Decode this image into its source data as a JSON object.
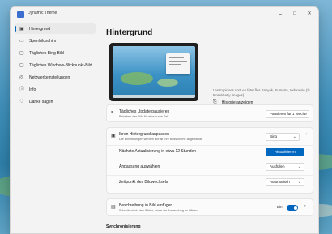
{
  "window": {
    "title": "Dynamic Theme",
    "minimize": "–",
    "maximize": "□",
    "close": "✕"
  },
  "sidebar": {
    "items": [
      {
        "label": "Hintergrund",
        "icon": "picture-icon",
        "active": true
      },
      {
        "label": "Sperrbildschirm",
        "icon": "monitor-icon",
        "active": false
      },
      {
        "label": "Tägliches Bing-Bild",
        "icon": "image-icon",
        "active": false
      },
      {
        "label": "Tägliches Windows-Blickpunkt-Bild",
        "icon": "image-icon",
        "active": false
      },
      {
        "label": "Netzwerkeinstellungen",
        "icon": "globe-icon",
        "active": false
      },
      {
        "label": "Info",
        "icon": "info-icon",
        "active": false
      },
      {
        "label": "Danke sagen",
        "icon": "heart-icon",
        "active": false
      }
    ]
  },
  "main": {
    "heading": "Hintergrund",
    "caption": "Les tropiques sont en fête! Îles Banyak, Sumatra, Indonésie (© Rose/Getty Images)",
    "history_link": "Historie anzeigen",
    "daily_update": {
      "title": "Tägliches Update pausieren",
      "subtitle": "Beheben das Bild für eine kurze Zeit",
      "dropdown": "Pausieren für 1 Woche"
    },
    "customize": {
      "title": "Ihren Hintergrund anpassen",
      "subtitle": "Die Einstellungen werden auf all Ihre Bildschirme angewandt",
      "dropdown": "Bing",
      "next_update_label": "Nächste Aktualisierung in etwa 12 Stunden",
      "refresh_button": "Aktualisieren",
      "fit_label": "Anpassung auswählen",
      "fit_value": "Ausfüllen",
      "timing_label": "Zeitpunkt des Bildwechsels",
      "timing_value": "Automatisch"
    },
    "description": {
      "title": "Beschreibung in Bild einfügen",
      "subtitle": "Schreibschutz des Bildes, ohne die Anwendung zu öffnen",
      "toggle_label": "Ein",
      "toggle_on": true
    },
    "section_sync": "Synchronisierung"
  },
  "colors": {
    "accent": "#0067c0",
    "window_bg": "#f3f3f3",
    "card_bg": "#fbfbfb"
  }
}
